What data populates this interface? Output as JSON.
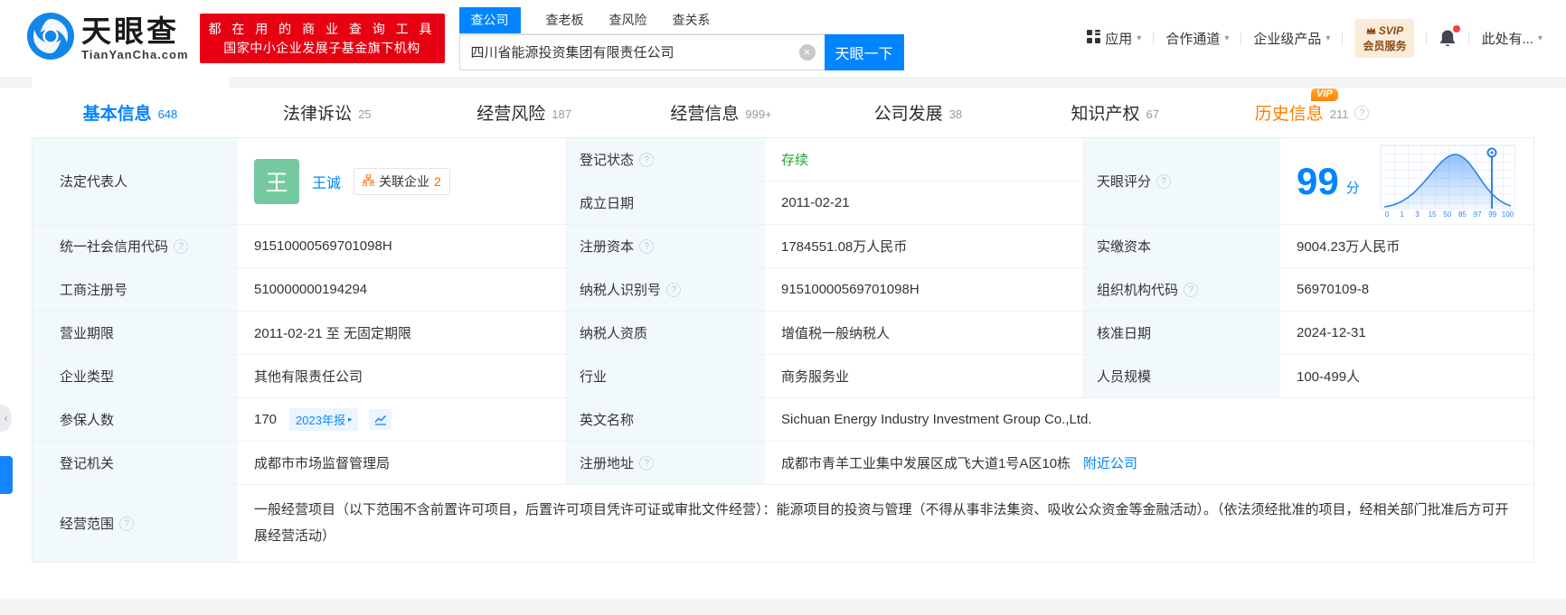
{
  "header": {
    "brand": "天眼查",
    "brand_domain": "TianYanCha.com",
    "slogan_line1": "都 在 用 的 商 业 查 询 工 具",
    "slogan_line2": "国家中小企业发展子基金旗下机构",
    "search": {
      "tabs": [
        "查公司",
        "查老板",
        "查风险",
        "查关系"
      ],
      "active_tab": "查公司",
      "input_value": "四川省能源投资集团有限责任公司",
      "button": "天眼一下"
    },
    "nav": {
      "apps": "应用",
      "cooperation": "合作通道",
      "enterprise": "企业级产品",
      "svip_top": "SVIP",
      "svip_bottom": "会员服务",
      "more": "此处有..."
    }
  },
  "tabs": [
    {
      "label": "基本信息",
      "count": "648"
    },
    {
      "label": "法律诉讼",
      "count": "25"
    },
    {
      "label": "经营风险",
      "count": "187"
    },
    {
      "label": "经营信息",
      "count": "999+"
    },
    {
      "label": "公司发展",
      "count": "38"
    },
    {
      "label": "知识产权",
      "count": "67"
    },
    {
      "label": "历史信息",
      "count": "211",
      "vip": "VIP"
    }
  ],
  "info": {
    "legal_rep": {
      "label": "法定代表人",
      "avatar": "王",
      "name": "王诚",
      "badge_label": "关联企业",
      "badge_count": "2"
    },
    "reg_status": {
      "label": "登记状态",
      "value": "存续"
    },
    "est_date": {
      "label": "成立日期",
      "value": "2011-02-21"
    },
    "score": {
      "label": "天眼评分",
      "value": "99",
      "unit": "分"
    },
    "credit_code": {
      "label": "统一社会信用代码",
      "value": "91510000569701098H"
    },
    "reg_capital": {
      "label": "注册资本",
      "value": "1784551.08万人民币"
    },
    "paid_capital": {
      "label": "实缴资本",
      "value": "9004.23万人民币"
    },
    "reg_number": {
      "label": "工商注册号",
      "value": "510000000194294"
    },
    "taxpayer_id": {
      "label": "纳税人识别号",
      "value": "91510000569701098H"
    },
    "org_code": {
      "label": "组织机构代码",
      "value": "56970109-8"
    },
    "business_term": {
      "label": "营业期限",
      "value": "2011-02-21 至 无固定期限"
    },
    "taxpayer_quality": {
      "label": "纳税人资质",
      "value": "增值税一般纳税人"
    },
    "approval_date": {
      "label": "核准日期",
      "value": "2024-12-31"
    },
    "company_type": {
      "label": "企业类型",
      "value": "其他有限责任公司"
    },
    "industry": {
      "label": "行业",
      "value": "商务服务业"
    },
    "staff_size": {
      "label": "人员规模",
      "value": "100-499人"
    },
    "insured": {
      "label": "参保人数",
      "value": "170",
      "report_badge": "2023年报"
    },
    "english_name": {
      "label": "英文名称",
      "value": "Sichuan Energy Industry Investment Group Co.,Ltd."
    },
    "reg_authority": {
      "label": "登记机关",
      "value": "成都市市场监督管理局"
    },
    "reg_address": {
      "label": "注册地址",
      "value": "成都市青羊工业集中发展区成飞大道1号A区10栋",
      "nearby_link": "附近公司"
    },
    "business_scope": {
      "label": "经营范围",
      "value": "一般经营项目（以下范围不含前置许可项目，后置许可项目凭许可证或审批文件经营）：能源项目的投资与管理（不得从事非法集资、吸收公众资金等金融活动）。（依法须经批准的项目，经相关部门批准后方可开展经营活动）"
    }
  },
  "chart_data": {
    "type": "area",
    "title": "天眼评分",
    "score": 99,
    "score_unit": "分",
    "x_ticks": [
      "0",
      "1",
      "3",
      "15",
      "50",
      "85",
      "97",
      "99",
      "100"
    ],
    "marker_at": "99",
    "curve": "bell",
    "ylabel": "",
    "xlabel": "",
    "grid": true,
    "legend": false
  },
  "icons": {
    "caret": "▾",
    "clear": "×",
    "help": "?",
    "badge_arrow": "▸",
    "collapse": "‹"
  },
  "colors": {
    "accent": "#0084ff",
    "banner_red": "#e60012",
    "status_green": "#23a33c",
    "history_orange": "#ff8000",
    "label_bg": "#f2f9fd",
    "avatar_green": "#76c8a0"
  }
}
